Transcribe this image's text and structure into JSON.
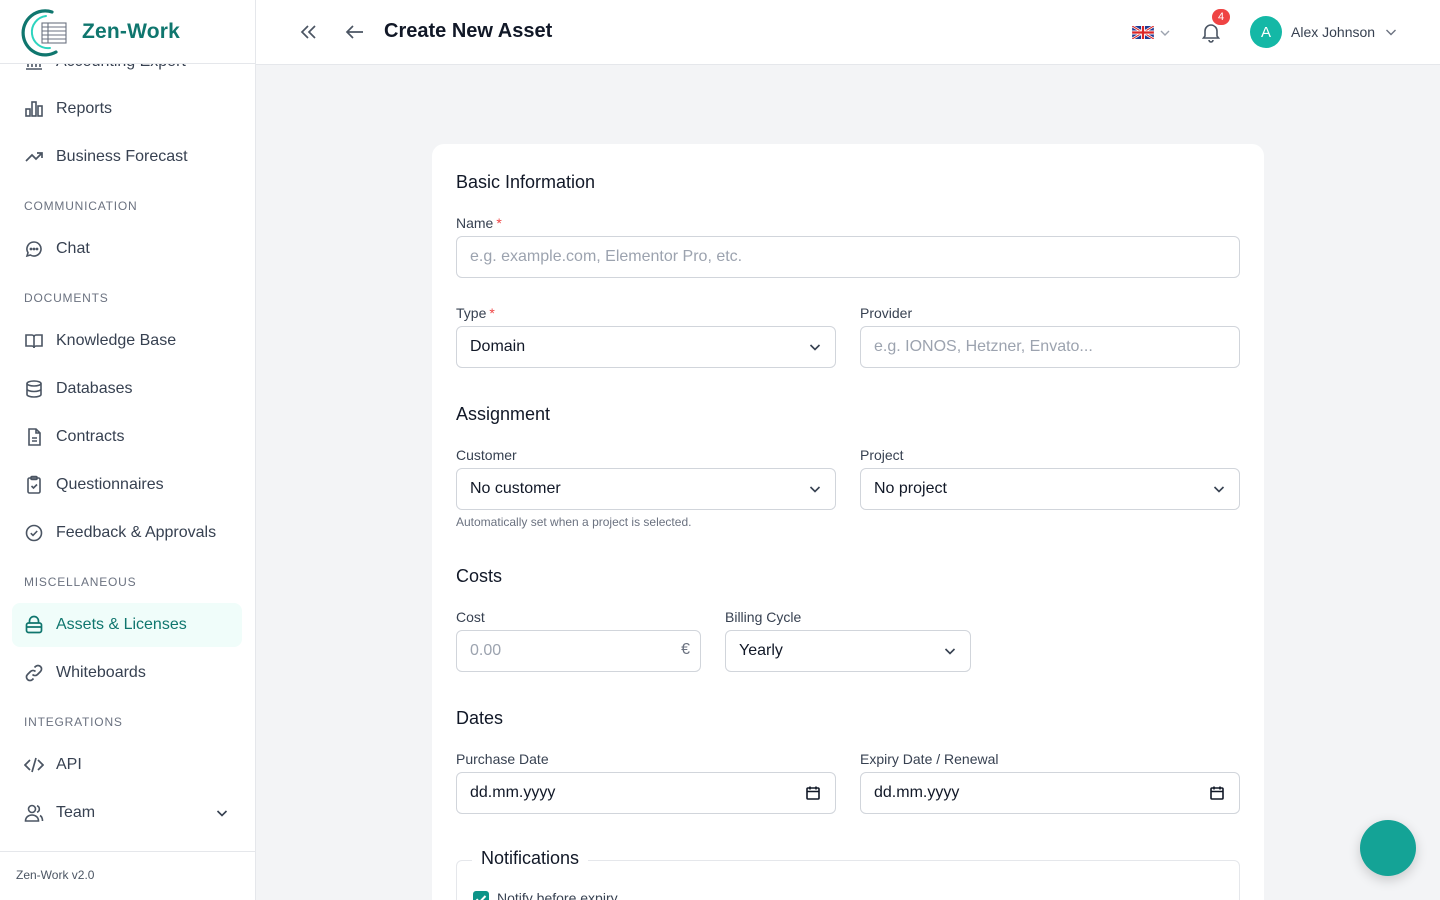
{
  "app": {
    "name": "Zen-Work",
    "version": "Zen-Work v2.0"
  },
  "sidebar": {
    "partial_item": "Accounting Export",
    "items": [
      {
        "label": "Reports",
        "icon": "bar-chart-icon"
      },
      {
        "label": "Business Forecast",
        "icon": "trending-up-icon"
      },
      {
        "label": "Chat",
        "icon": "chat-bubble-icon"
      },
      {
        "label": "Knowledge Base",
        "icon": "book-open-icon"
      },
      {
        "label": "Databases",
        "icon": "database-icon"
      },
      {
        "label": "Contracts",
        "icon": "document-icon"
      },
      {
        "label": "Questionnaires",
        "icon": "clipboard-check-icon"
      },
      {
        "label": "Feedback & Approvals",
        "icon": "check-circle-icon"
      },
      {
        "label": "Assets & Licenses",
        "icon": "lock-icon",
        "active": true
      },
      {
        "label": "Whiteboards",
        "icon": "link-icon"
      },
      {
        "label": "API",
        "icon": "code-icon"
      },
      {
        "label": "Team",
        "icon": "users-icon"
      }
    ],
    "sections": {
      "communication": "COMMUNICATION",
      "documents": "DOCUMENTS",
      "miscellaneous": "MISCELLANEOUS",
      "integrations": "INTEGRATIONS"
    }
  },
  "header": {
    "title": "Create New Asset",
    "notification_count": "4",
    "user": {
      "initial": "A",
      "name": "Alex Johnson"
    }
  },
  "form": {
    "basic_title": "Basic Information",
    "name": {
      "label": "Name",
      "required": "*",
      "placeholder": "e.g. example.com, Elementor Pro, etc."
    },
    "type": {
      "label": "Type",
      "required": "*",
      "value": "Domain"
    },
    "provider": {
      "label": "Provider",
      "placeholder": "e.g. IONOS, Hetzner, Envato..."
    },
    "assignment_title": "Assignment",
    "customer": {
      "label": "Customer",
      "value": "No customer",
      "help": "Automatically set when a project is selected."
    },
    "project": {
      "label": "Project",
      "value": "No project"
    },
    "costs_title": "Costs",
    "cost": {
      "label": "Cost",
      "placeholder": "0.00",
      "currency": "€"
    },
    "billing": {
      "label": "Billing Cycle",
      "value": "Yearly"
    },
    "dates_title": "Dates",
    "purchase": {
      "label": "Purchase Date",
      "value": "dd.mm.yyyy"
    },
    "expiry": {
      "label": "Expiry Date / Renewal",
      "value": "dd.mm.yyyy"
    },
    "notifications_title": "Notifications",
    "notify_label": "Notify before expiry"
  },
  "colors": {
    "accent": "#0f766e",
    "active_bg": "#f0fdfa",
    "badge": "#ef4444",
    "avatar": "#14b8a6",
    "fab": "#14a396"
  }
}
